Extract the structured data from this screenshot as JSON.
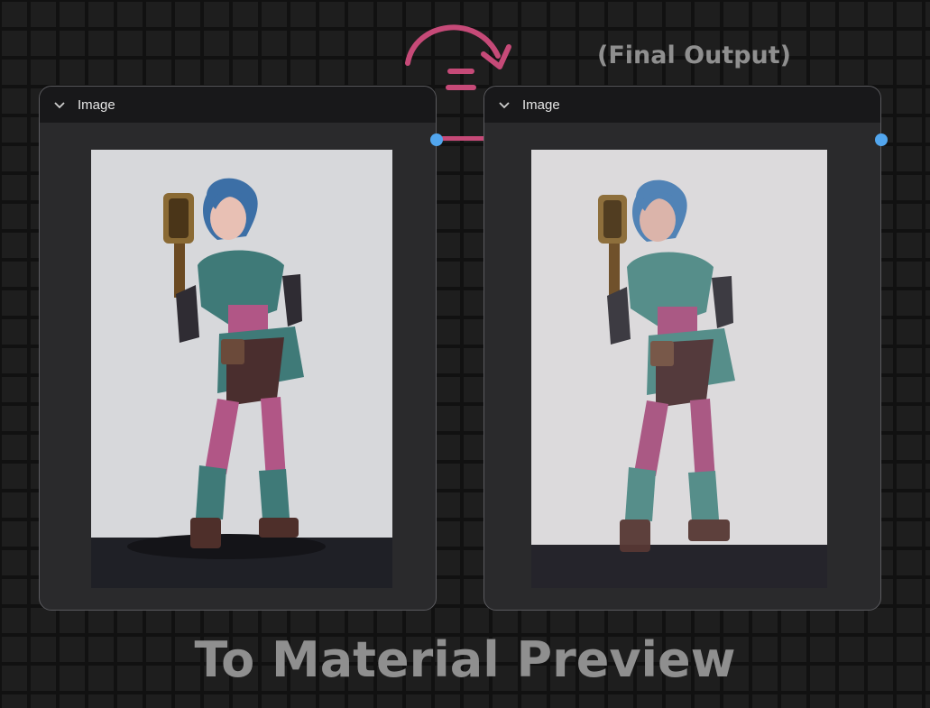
{
  "nodes": {
    "left": {
      "title": "Image"
    },
    "right": {
      "title": "Image"
    }
  },
  "labels": {
    "final_output": "(Final Output)",
    "footer": "To Material Preview"
  },
  "colors": {
    "canvas_bg": "#1e1e1e",
    "grid_line": "#111111",
    "node_bg": "#2a2a2c",
    "node_header": "#18181a",
    "port": "#52a6ee",
    "connector": "#c64a78",
    "annotation_arrow": "#c64a78",
    "caption_text": "#8f8f8f"
  },
  "icons": {
    "collapse": "chevron-down-icon",
    "arrow": "curved-arrow-icon",
    "equals": "equals-icon"
  }
}
